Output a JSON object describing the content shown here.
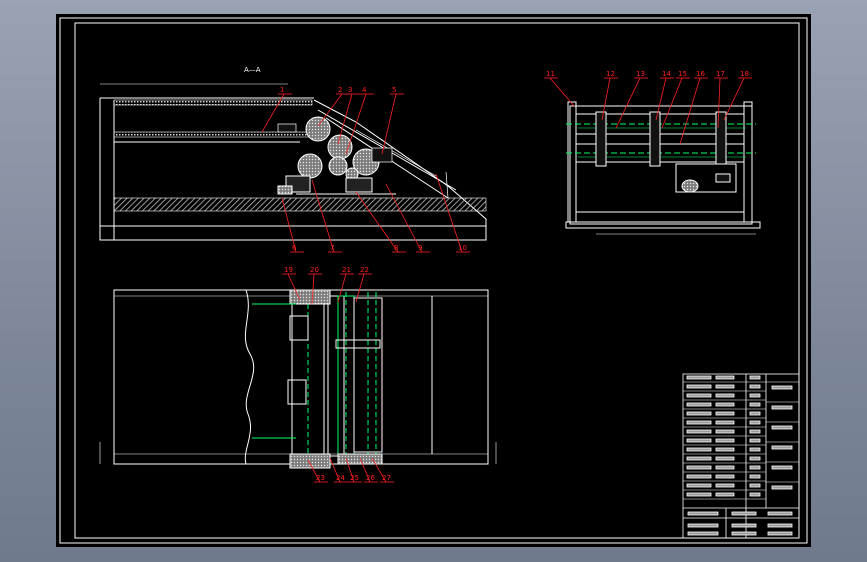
{
  "drawing": {
    "view_title": "A—A",
    "side_view": {
      "part_numbers_top": [
        "1",
        "2",
        "3",
        "4",
        "5"
      ],
      "part_numbers_bottom": [
        "6",
        "7",
        "8",
        "9",
        "10"
      ]
    },
    "end_view": {
      "part_numbers": [
        "11",
        "12",
        "13",
        "14",
        "15",
        "16",
        "17",
        "18"
      ]
    },
    "plan_view": {
      "part_numbers_top": [
        "19",
        "20",
        "21",
        "22"
      ],
      "part_numbers_bottom": [
        "23",
        "24",
        "25",
        "26",
        "27"
      ]
    }
  },
  "colors": {
    "background": "#000000",
    "linework": "#ffffff",
    "dimensions": "#00ff00",
    "callouts": "#ff2020",
    "hidden": "#00ff66",
    "hatch": "#bfbfbf"
  }
}
